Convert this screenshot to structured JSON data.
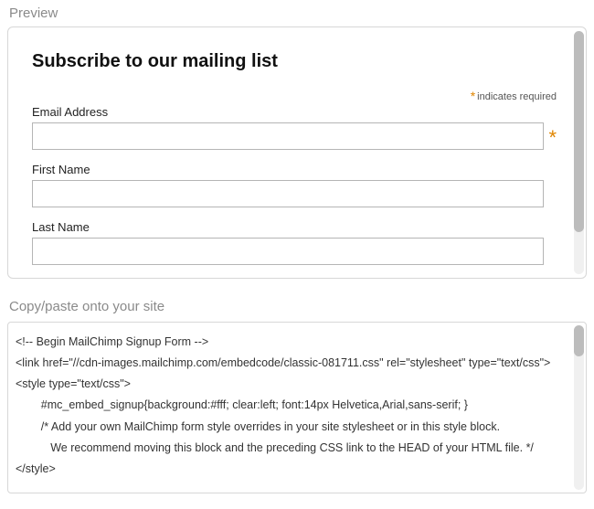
{
  "preview": {
    "section_label": "Preview",
    "form_title": "Subscribe to our mailing list",
    "required_star": "*",
    "required_text": "indicates required",
    "email_label": "Email Address",
    "first_name_label": "First Name",
    "last_name_label": "Last Name"
  },
  "copy": {
    "section_label": "Copy/paste onto your site",
    "code": "<!-- Begin MailChimp Signup Form -->\n<link href=\"//cdn-images.mailchimp.com/embedcode/classic-081711.css\" rel=\"stylesheet\" type=\"text/css\">\n<style type=\"text/css\">\n        #mc_embed_signup{background:#fff; clear:left; font:14px Helvetica,Arial,sans-serif; }\n        /* Add your own MailChimp form style overrides in your site stylesheet or in this style block.\n           We recommend moving this block and the preceding CSS link to the HEAD of your HTML file. */\n</style>"
  }
}
